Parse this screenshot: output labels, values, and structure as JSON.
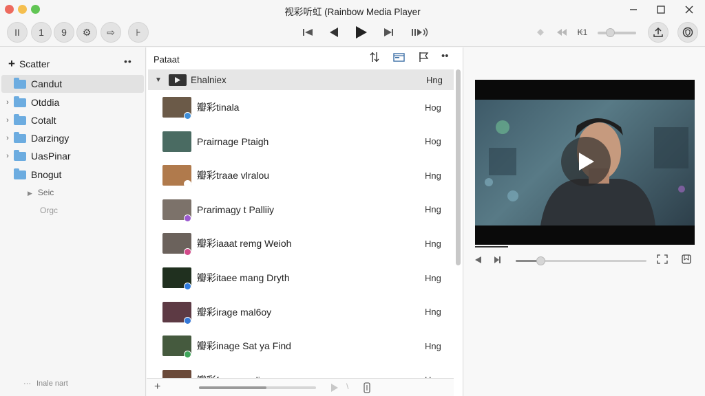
{
  "window": {
    "title": "视彩听虹 (Rainbow Media Player",
    "traffic_colors": {
      "close": "#ed6a5e",
      "minimize": "#f5bf4f",
      "zoom": "#61c554"
    }
  },
  "toolbar": {
    "left_buttons": [
      {
        "icon": "pause-icon",
        "glyph": "II"
      },
      {
        "icon": "info-icon",
        "glyph": "1"
      },
      {
        "icon": "help-icon",
        "glyph": "9"
      },
      {
        "icon": "settings-icon",
        "glyph": "⚙"
      },
      {
        "icon": "share-icon",
        "glyph": "⇨"
      },
      {
        "icon": "marker-icon",
        "glyph": "⊦"
      }
    ],
    "volume_label": "₭1",
    "volume_level": 0.33
  },
  "sidebar": {
    "header": "Scatter",
    "items": [
      {
        "label": "Candut",
        "expandable": false,
        "selected": true
      },
      {
        "label": "Otddia",
        "expandable": true,
        "selected": false
      },
      {
        "label": "Cotalt",
        "expandable": true,
        "selected": false
      },
      {
        "label": "Darzingy",
        "expandable": true,
        "selected": false
      },
      {
        "label": "UasPinar",
        "expandable": true,
        "selected": false
      },
      {
        "label": "Bnogut",
        "expandable": false,
        "selected": false
      }
    ],
    "subitems": [
      "Seic",
      "Orgc"
    ],
    "footer": "Inale nart"
  },
  "list": {
    "header": "Pataat",
    "group": {
      "label": "Ehalniex",
      "meta": "Hng"
    },
    "rows": [
      {
        "title": "瓣彩tinala",
        "meta": "Hog",
        "thumb": "#6b5a48",
        "badge": "#3f8fd9"
      },
      {
        "title": "Prairnage Ptaigh",
        "meta": "Hog",
        "thumb": "#4a6b62",
        "badge": ""
      },
      {
        "title": "瓣彩traae vlralou",
        "meta": "Hng",
        "thumb": "#b07a4c",
        "badge": "#ffffff"
      },
      {
        "title": "Prarimagy t Palliiy",
        "meta": "Hng",
        "thumb": "#7c726a",
        "badge": "#9b59d0"
      },
      {
        "title": "瓣彩iaaat remg Weioh",
        "meta": "Hng",
        "thumb": "#6b625c",
        "badge": "#d34a8a"
      },
      {
        "title": "瓣彩itaee mang Dryth",
        "meta": "Hng",
        "thumb": "#20301f",
        "badge": "#2f7be0"
      },
      {
        "title": "瓣彩irage mal6oy",
        "meta": "Hng",
        "thumb": "#5d3a44",
        "badge": "#3478d8"
      },
      {
        "title": "瓣彩inage Sat ya Find",
        "meta": "Hng",
        "thumb": "#455a3e",
        "badge": "#3fa55a"
      },
      {
        "title": "瓣彩foxge maliaoy",
        "meta": "Hng",
        "thumb": "#6a4a3a",
        "badge": "#d33a3a"
      }
    ]
  },
  "preview": {
    "progress": 0.15,
    "seek_fill": 0.19
  }
}
